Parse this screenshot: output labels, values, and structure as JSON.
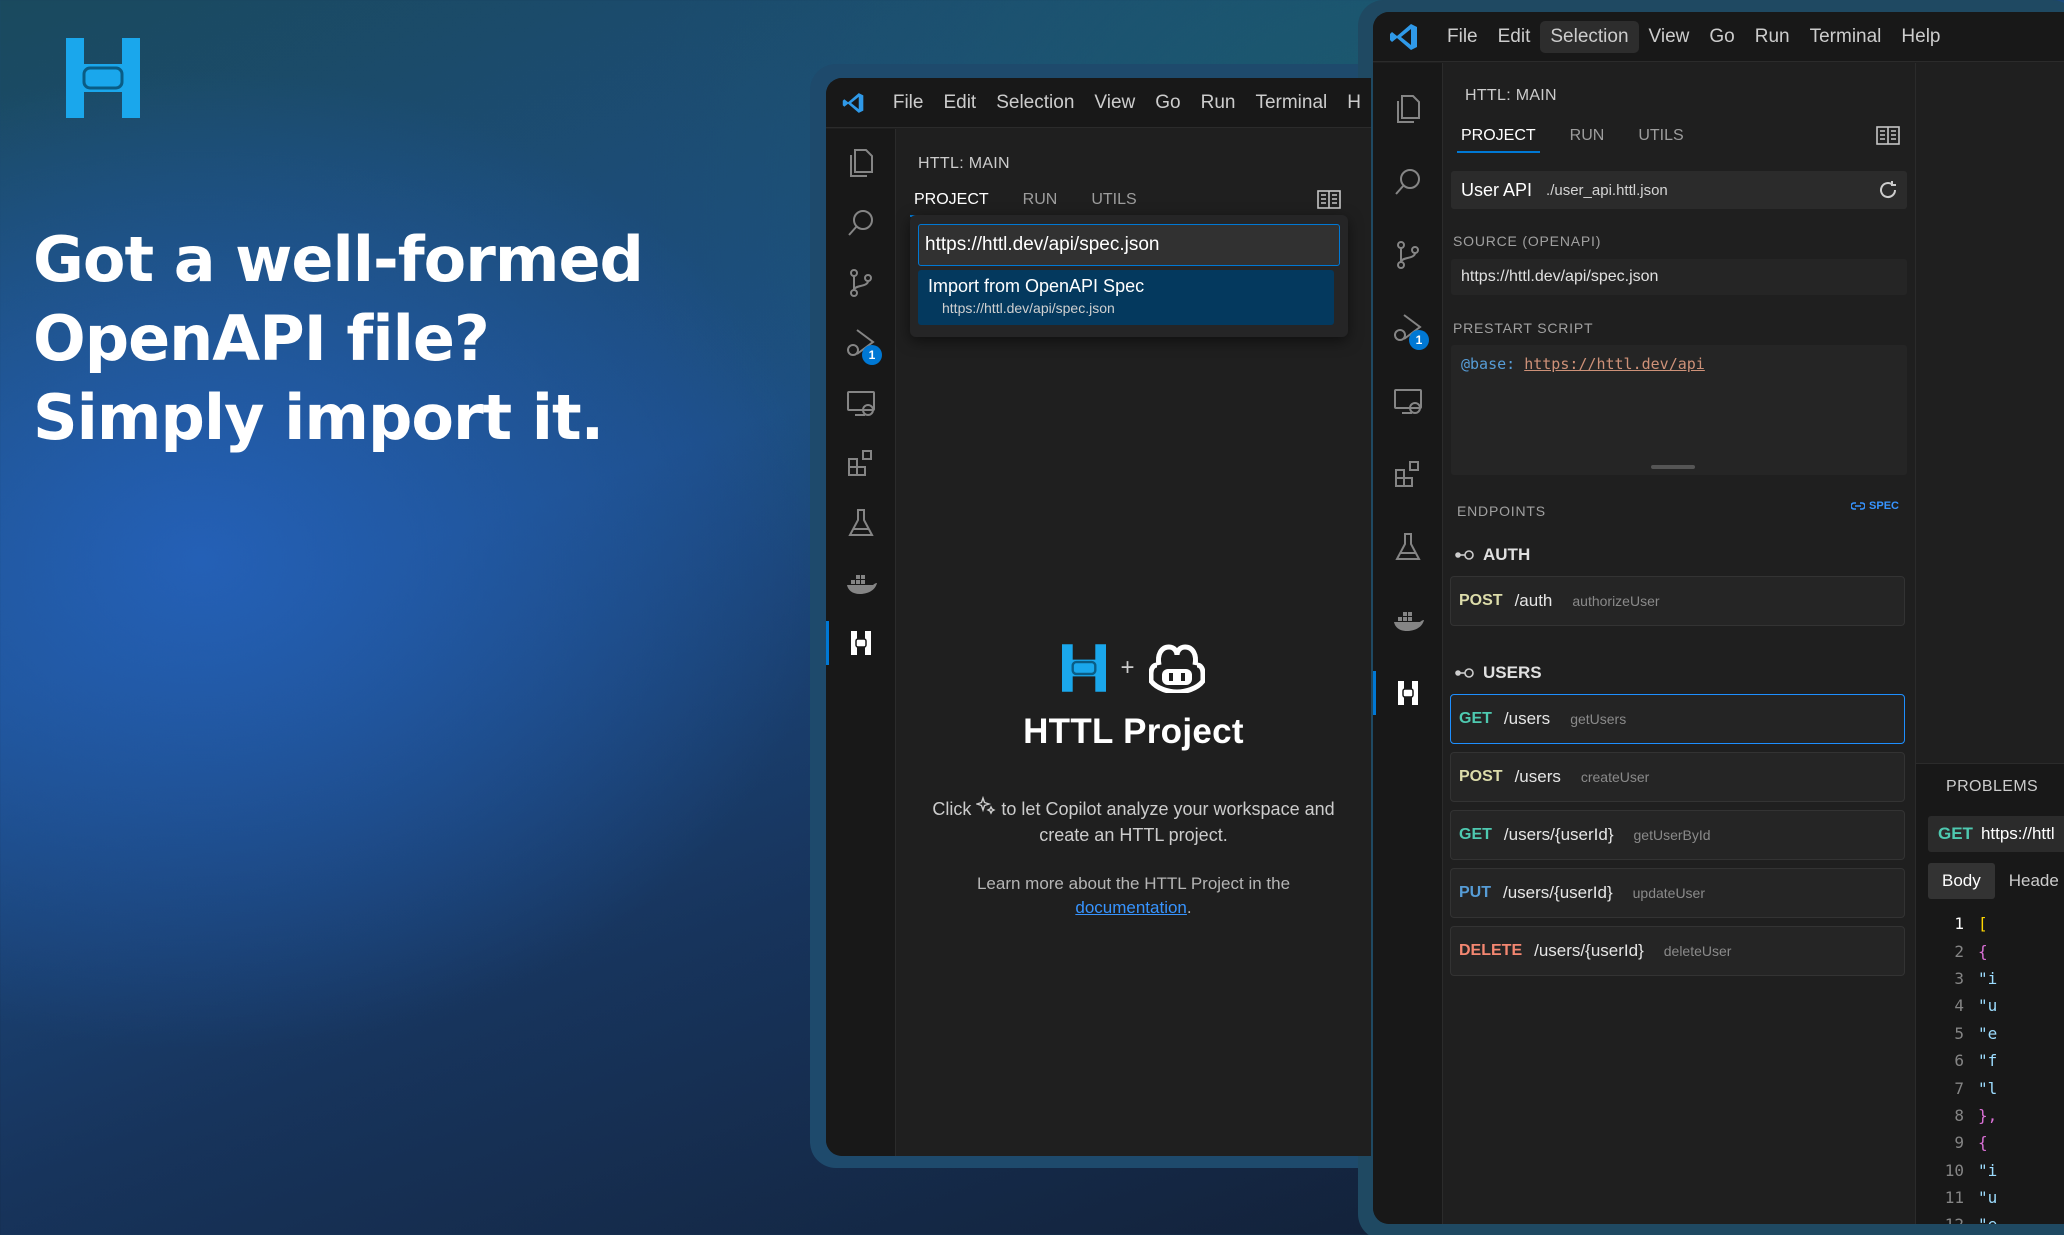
{
  "hero": {
    "headline": "Got a well-formed OpenAPI file? Simply import it."
  },
  "colors": {
    "accent": "#0078d4",
    "httl_brand": "#1aa7ec",
    "method_get": "#4ec9b0",
    "method_post": "#dcdcaa",
    "method_put": "#569cd6",
    "method_delete": "#f48771"
  },
  "window_a": {
    "menu": [
      "File",
      "Edit",
      "Selection",
      "View",
      "Go",
      "Run",
      "Terminal",
      "H"
    ],
    "sidebar_title": "HTTL: MAIN",
    "tabs": [
      "PROJECT",
      "RUN",
      "UTILS"
    ],
    "quick_pick": {
      "input_value": "https://httl.dev/api/spec.json",
      "item_label": "Import from OpenAPI Spec",
      "item_detail": "https://httl.dev/api/spec.json"
    },
    "welcome": {
      "plus": "+",
      "title": "HTTL Project",
      "desc_before": "Click",
      "desc_after": "to let Copilot analyze your workspace and create an HTTL project.",
      "learn_text": "Learn more about the HTTL Project in the",
      "learn_link": "documentation",
      "learn_end": "."
    },
    "activity_icons": [
      "files-icon",
      "search-icon",
      "source-control-icon",
      "run-debug-icon",
      "remote-explorer-icon",
      "extensions-icon",
      "testing-icon",
      "docker-icon",
      "httl-icon"
    ],
    "run_badge": "1"
  },
  "window_b": {
    "menu": [
      "File",
      "Edit",
      "Selection",
      "View",
      "Go",
      "Run",
      "Terminal",
      "Help"
    ],
    "active_menu": "Selection",
    "sidebar_title": "HTTL: MAIN",
    "tabs": [
      "PROJECT",
      "RUN",
      "UTILS"
    ],
    "api": {
      "name": "User API",
      "path": "./user_api.httl.json"
    },
    "source_label": "SOURCE (OPENAPI)",
    "source_value": "https://httl.dev/api/spec.json",
    "prestart_label": "PRESTART SCRIPT",
    "prestart_keyword": "@base:",
    "prestart_url": "https://httl.dev/api",
    "endpoints_label": "ENDPOINTS",
    "spec_tag": "SPEC",
    "groups": [
      {
        "name": "AUTH",
        "endpoints": [
          {
            "method": "POST",
            "path": "/auth",
            "operation": "authorizeUser"
          }
        ]
      },
      {
        "name": "USERS",
        "endpoints": [
          {
            "method": "GET",
            "path": "/users",
            "operation": "getUsers"
          },
          {
            "method": "POST",
            "path": "/users",
            "operation": "createUser"
          },
          {
            "method": "GET",
            "path": "/users/{userId}",
            "operation": "getUserById"
          },
          {
            "method": "PUT",
            "path": "/users/{userId}",
            "operation": "updateUser"
          },
          {
            "method": "DELETE",
            "path": "/users/{userId}",
            "operation": "deleteUser"
          }
        ]
      }
    ],
    "run_badge": "1",
    "panel": {
      "title": "PROBLEMS",
      "request_method": "GET",
      "request_url": "https://httl",
      "body_tabs": [
        "Body",
        "Heade"
      ],
      "code_lines": [
        {
          "n": "1",
          "t": "["
        },
        {
          "n": "2",
          "t": "  {"
        },
        {
          "n": "3",
          "t": "    \"i"
        },
        {
          "n": "4",
          "t": "    \"u"
        },
        {
          "n": "5",
          "t": "    \"e"
        },
        {
          "n": "6",
          "t": "    \"f"
        },
        {
          "n": "7",
          "t": "    \"l"
        },
        {
          "n": "8",
          "t": "  },"
        },
        {
          "n": "9",
          "t": "  {"
        },
        {
          "n": "10",
          "t": "    \"i"
        },
        {
          "n": "11",
          "t": "    \"u"
        },
        {
          "n": "12",
          "t": "    \"e"
        }
      ]
    }
  }
}
